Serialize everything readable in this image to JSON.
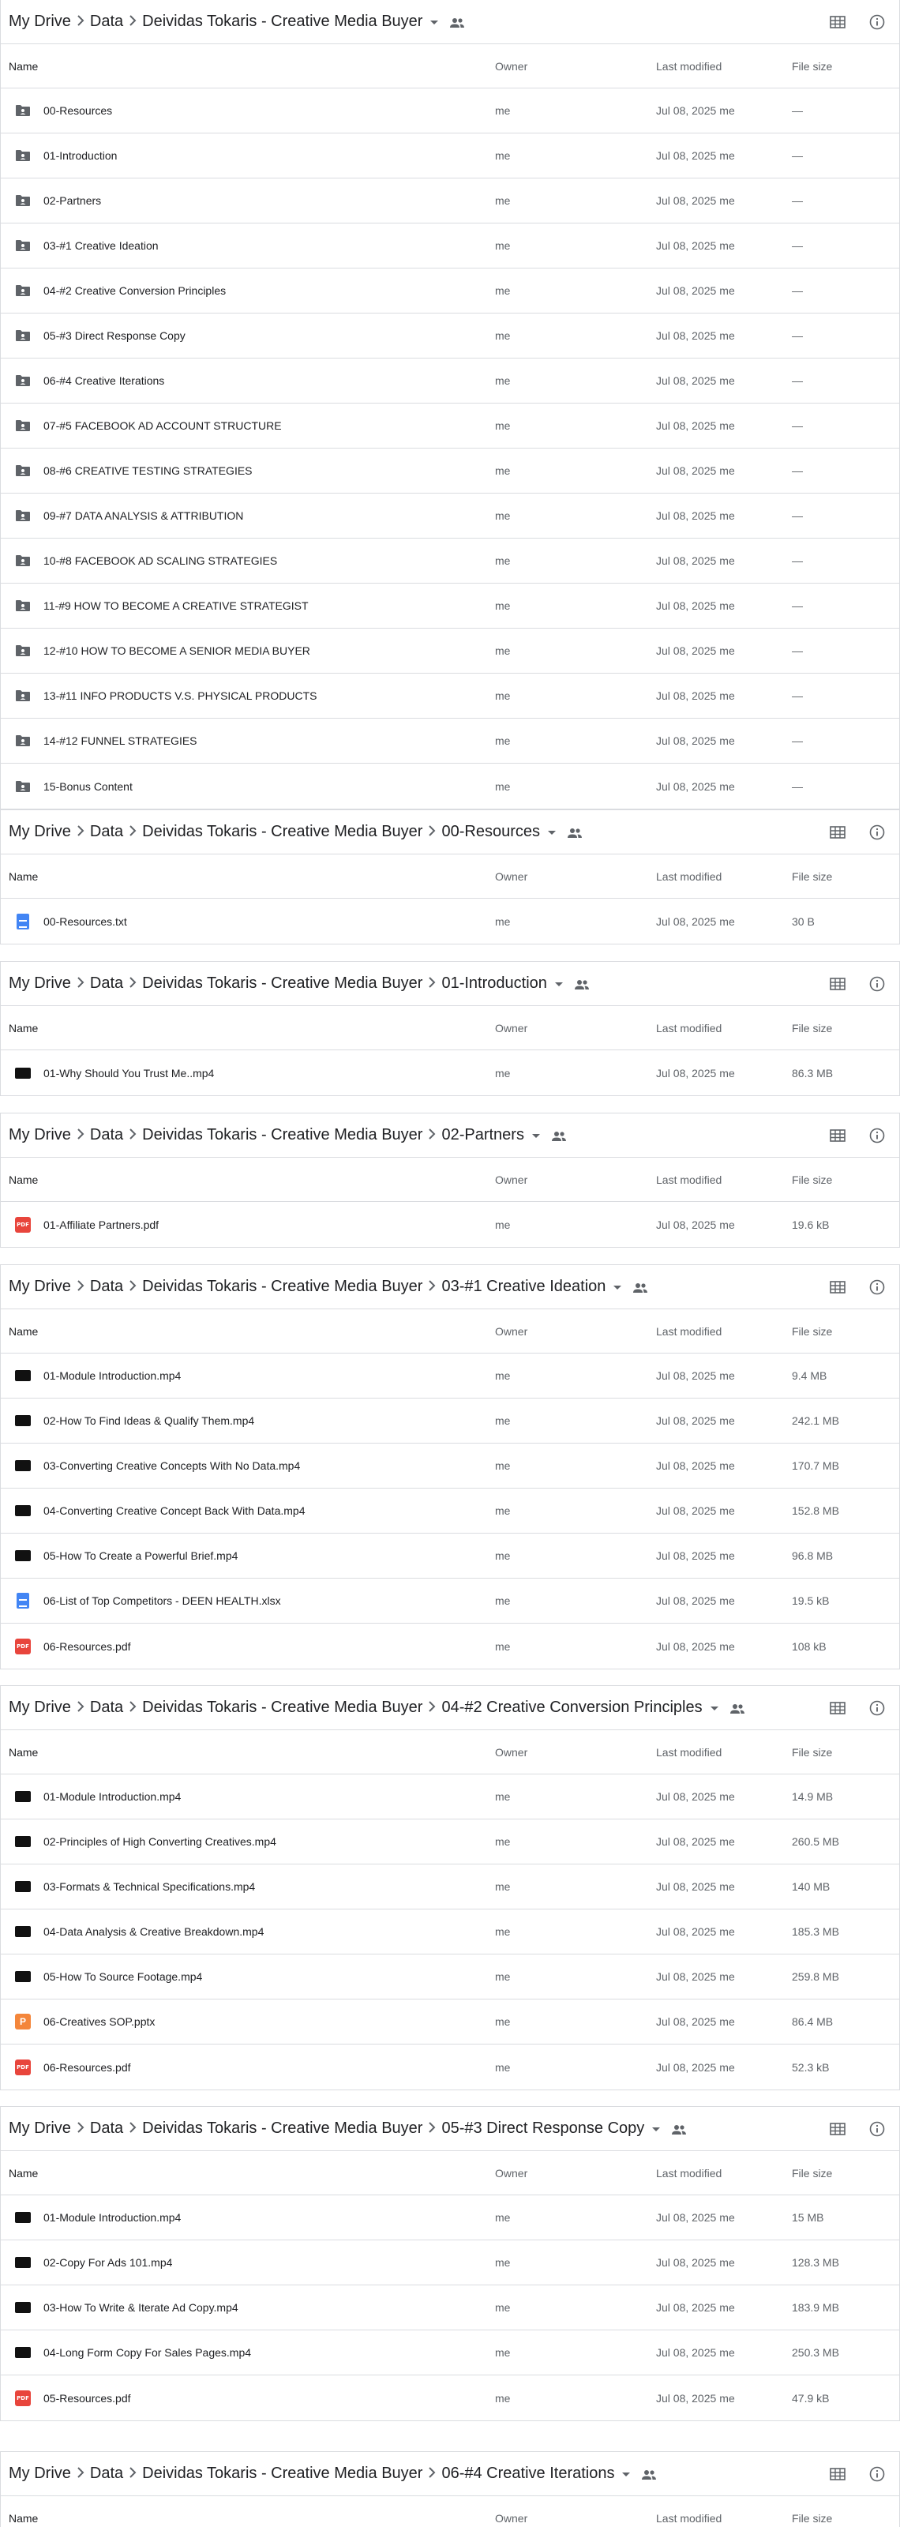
{
  "common": {
    "owner": "me",
    "modified": "Jul 08, 2025",
    "modified_by": "me",
    "col_name": "Name",
    "col_owner": "Owner",
    "col_modified": "Last modified",
    "col_size": "File size",
    "crumb_root": "My Drive",
    "crumb_data": "Data",
    "crumb_course": "Deividas Tokaris - Creative Media Buyer",
    "dash": "—"
  },
  "panels": [
    {
      "crumb_last": "",
      "files": [
        {
          "name": "00-Resources",
          "type": "folder",
          "size": "—"
        },
        {
          "name": "01-Introduction",
          "type": "folder",
          "size": "—"
        },
        {
          "name": "02-Partners",
          "type": "folder",
          "size": "—"
        },
        {
          "name": "03-#1 Creative Ideation",
          "type": "folder",
          "size": "—"
        },
        {
          "name": "04-#2 Creative Conversion Principles",
          "type": "folder",
          "size": "—"
        },
        {
          "name": "05-#3 Direct Response Copy",
          "type": "folder",
          "size": "—"
        },
        {
          "name": "06-#4 Creative Iterations",
          "type": "folder",
          "size": "—"
        },
        {
          "name": "07-#5 FACEBOOK AD ACCOUNT STRUCTURE",
          "type": "folder",
          "size": "—"
        },
        {
          "name": "08-#6 CREATIVE TESTING STRATEGIES",
          "type": "folder",
          "size": "—"
        },
        {
          "name": "09-#7 DATA ANALYSIS & ATTRIBUTION",
          "type": "folder",
          "size": "—"
        },
        {
          "name": "10-#8 FACEBOOK AD SCALING STRATEGIES",
          "type": "folder",
          "size": "—"
        },
        {
          "name": "11-#9 HOW TO BECOME A CREATIVE STRATEGIST",
          "type": "folder",
          "size": "—"
        },
        {
          "name": "12-#10 HOW TO BECOME A SENIOR MEDIA BUYER",
          "type": "folder",
          "size": "—"
        },
        {
          "name": "13-#11 INFO PRODUCTS V.S. PHYSICAL PRODUCTS",
          "type": "folder",
          "size": "—"
        },
        {
          "name": "14-#12 FUNNEL STRATEGIES",
          "type": "folder",
          "size": "—"
        },
        {
          "name": "15-Bonus Content",
          "type": "folder",
          "size": "—"
        }
      ]
    },
    {
      "crumb_last": "00-Resources",
      "files": [
        {
          "name": "00-Resources.txt",
          "type": "doc",
          "size": "30 B"
        }
      ]
    },
    {
      "crumb_last": "01-Introduction",
      "files": [
        {
          "name": "01-Why Should You Trust Me..mp4",
          "type": "video",
          "size": "86.3 MB"
        }
      ]
    },
    {
      "crumb_last": "02-Partners",
      "files": [
        {
          "name": "01-Affiliate Partners.pdf",
          "type": "pdf",
          "size": "19.6 kB"
        }
      ]
    },
    {
      "crumb_last": "03-#1 Creative Ideation",
      "files": [
        {
          "name": "01-Module Introduction.mp4",
          "type": "video",
          "size": "9.4 MB"
        },
        {
          "name": "02-How To Find Ideas & Qualify Them.mp4",
          "type": "video",
          "size": "242.1 MB"
        },
        {
          "name": "03-Converting Creative Concepts With No Data.mp4",
          "type": "video",
          "size": "170.7 MB"
        },
        {
          "name": "04-Converting Creative Concept Back With Data.mp4",
          "type": "video",
          "size": "152.8 MB"
        },
        {
          "name": "05-How To Create a Powerful Brief.mp4",
          "type": "video",
          "size": "96.8 MB"
        },
        {
          "name": "06-List of Top Competitors - DEEN HEALTH.xlsx",
          "type": "doc",
          "size": "19.5 kB"
        },
        {
          "name": "06-Resources.pdf",
          "type": "pdf",
          "size": "108 kB"
        }
      ]
    },
    {
      "crumb_last": "04-#2 Creative Conversion Principles",
      "files": [
        {
          "name": "01-Module Introduction.mp4",
          "type": "video",
          "size": "14.9 MB"
        },
        {
          "name": "02-Principles of High Converting Creatives.mp4",
          "type": "video",
          "size": "260.5 MB"
        },
        {
          "name": "03-Formats & Technical Specifications.mp4",
          "type": "video",
          "size": "140 MB"
        },
        {
          "name": "04-Data Analysis & Creative Breakdown.mp4",
          "type": "video",
          "size": "185.3 MB"
        },
        {
          "name": "05-How To Source Footage.mp4",
          "type": "video",
          "size": "259.8 MB"
        },
        {
          "name": "06-Creatives SOP.pptx",
          "type": "ppt",
          "size": "86.4 MB"
        },
        {
          "name": "06-Resources.pdf",
          "type": "pdf",
          "size": "52.3 kB"
        }
      ]
    },
    {
      "crumb_last": "05-#3 Direct Response Copy",
      "files": [
        {
          "name": "01-Module Introduction.mp4",
          "type": "video",
          "size": "15 MB"
        },
        {
          "name": "02-Copy For Ads 101.mp4",
          "type": "video",
          "size": "128.3 MB"
        },
        {
          "name": "03-How To Write & Iterate Ad Copy.mp4",
          "type": "video",
          "size": "183.9 MB"
        },
        {
          "name": "04-Long Form Copy For Sales Pages.mp4",
          "type": "video",
          "size": "250.3 MB"
        },
        {
          "name": "05-Resources.pdf",
          "type": "pdf",
          "size": "47.9 kB"
        }
      ]
    },
    {
      "crumb_last": "06-#4 Creative Iterations",
      "files": []
    }
  ],
  "icons": {
    "grid": "grid-view-icon",
    "info": "info-icon",
    "people": "shared-people-icon",
    "folder": "shared-folder-icon",
    "video": "video-file-icon",
    "pdf": "pdf-file-icon",
    "doc": "doc-file-icon",
    "ppt": "ppt-file-icon"
  },
  "colors": {
    "folder": "#5f6368",
    "pdf": "#e8453c",
    "doc": "#4285f4",
    "ppt": "#f4863b",
    "video": "#111111",
    "divider": "#dadce0"
  }
}
